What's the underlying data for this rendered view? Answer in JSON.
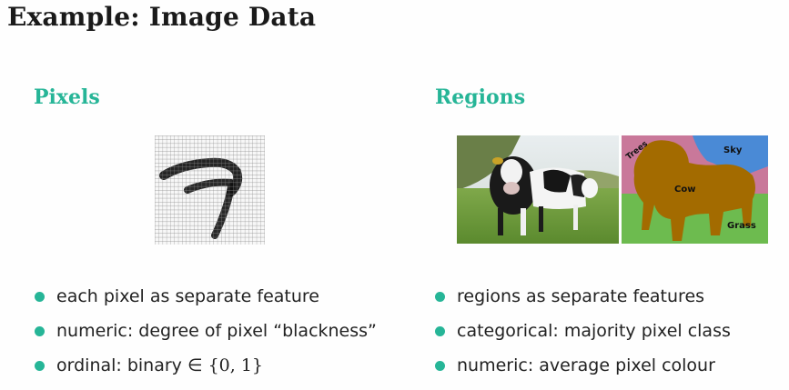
{
  "slide": {
    "title": "Example: Image Data"
  },
  "theme": {
    "accent": "#26b597",
    "bullet_color": "#26b597",
    "text": "#222222"
  },
  "left": {
    "heading": "Pixels",
    "figure_icon": "handwritten-digit-pixel-grid",
    "bullets": [
      {
        "text": "each pixel as separate feature"
      },
      {
        "text": "numeric: degree of pixel “blackness”"
      },
      {
        "text": "ordinal: binary ∈ ",
        "math": "{0, 1}"
      }
    ]
  },
  "right": {
    "heading": "Regions",
    "photo_icon": "cows-in-field-photo",
    "segmentation": {
      "labels": {
        "trees": "Trees",
        "sky": "Sky",
        "cow": "Cow",
        "grass": "Grass"
      },
      "colors": {
        "trees": "#c9789a",
        "sky": "#4a8ad6",
        "cow": "#a36b00",
        "grass": "#6dbb4f"
      }
    },
    "bullets": [
      {
        "text": "regions as separate features"
      },
      {
        "text": "categorical: majority pixel class"
      },
      {
        "text": "numeric: average pixel colour"
      }
    ]
  }
}
